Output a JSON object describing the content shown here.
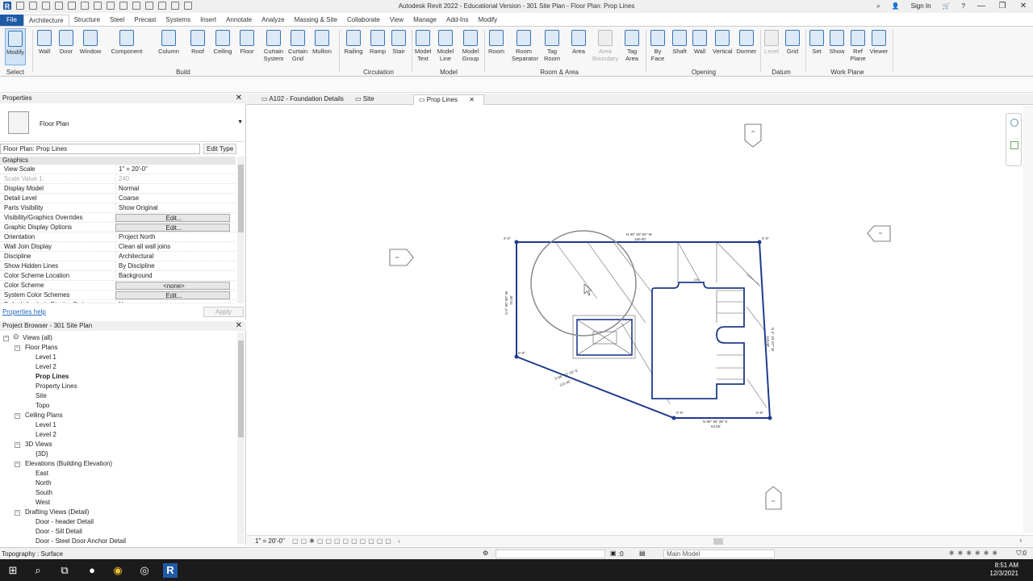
{
  "window": {
    "title": "Autodesk Revit 2022 - Educational Version - 301 Site Plan - Floor Plan: Prop Lines",
    "sign_in": "Sign In"
  },
  "ribbon_tabs": [
    "File",
    "Architecture",
    "Structure",
    "Steel",
    "Precast",
    "Systems",
    "Insert",
    "Annotate",
    "Analyze",
    "Massing & Site",
    "Collaborate",
    "View",
    "Manage",
    "Add-Ins",
    "Modify"
  ],
  "ribbon_active_tab": "Architecture",
  "ribbon": {
    "select_label": "Select",
    "buttons": [
      {
        "id": "modify",
        "label": "Modify"
      },
      {
        "id": "wall",
        "label": "Wall"
      },
      {
        "id": "door",
        "label": "Door"
      },
      {
        "id": "window",
        "label": "Window"
      },
      {
        "id": "component",
        "label": "Component"
      },
      {
        "id": "column",
        "label": "Column"
      },
      {
        "id": "roof",
        "label": "Roof"
      },
      {
        "id": "ceiling",
        "label": "Ceiling"
      },
      {
        "id": "floor",
        "label": "Floor"
      },
      {
        "id": "curtain-system",
        "label": "Curtain System"
      },
      {
        "id": "curtain-grid",
        "label": "Curtain Grid"
      },
      {
        "id": "mullion",
        "label": "Mullion"
      },
      {
        "id": "railing",
        "label": "Railing"
      },
      {
        "id": "ramp",
        "label": "Ramp"
      },
      {
        "id": "stair",
        "label": "Stair"
      },
      {
        "id": "model-text",
        "label": "Model Text"
      },
      {
        "id": "model-line",
        "label": "Model Line"
      },
      {
        "id": "model-group",
        "label": "Model Group"
      },
      {
        "id": "room",
        "label": "Room"
      },
      {
        "id": "room-separator",
        "label": "Room Separator"
      },
      {
        "id": "tag-room",
        "label": "Tag Room"
      },
      {
        "id": "area",
        "label": "Area"
      },
      {
        "id": "area-boundary",
        "label": "Area Boundary"
      },
      {
        "id": "tag-area",
        "label": "Tag Area"
      },
      {
        "id": "by-face",
        "label": "By Face"
      },
      {
        "id": "shaft",
        "label": "Shaft"
      },
      {
        "id": "opening-wall",
        "label": "Wall"
      },
      {
        "id": "vertical",
        "label": "Vertical"
      },
      {
        "id": "dormer",
        "label": "Dormer"
      },
      {
        "id": "level",
        "label": "Level"
      },
      {
        "id": "grid",
        "label": "Grid"
      },
      {
        "id": "set",
        "label": "Set"
      },
      {
        "id": "show",
        "label": "Show"
      },
      {
        "id": "ref-plane",
        "label": "Ref Plane"
      },
      {
        "id": "viewer",
        "label": "Viewer"
      }
    ],
    "panels": [
      "Build",
      "Circulation",
      "Model",
      "Room & Area",
      "Opening",
      "Datum",
      "Work Plane"
    ]
  },
  "properties": {
    "header": "Properties",
    "type_name": "Floor Plan",
    "instance_selector": "Floor Plan: Prop Lines",
    "edit_type": "Edit Type",
    "group": "Graphics",
    "rows": [
      {
        "key": "View Scale",
        "value": "1\" = 20'-0\""
      },
      {
        "key": "Scale Value    1:",
        "value": "240"
      },
      {
        "key": "Display Model",
        "value": "Normal"
      },
      {
        "key": "Detail Level",
        "value": "Coarse"
      },
      {
        "key": "Parts Visibility",
        "value": "Show Original"
      },
      {
        "key": "Visibility/Graphics Overrides",
        "value": "Edit..."
      },
      {
        "key": "Graphic Display Options",
        "value": "Edit..."
      },
      {
        "key": "Orientation",
        "value": "Project North"
      },
      {
        "key": "Wall Join Display",
        "value": "Clean all wall joins"
      },
      {
        "key": "Discipline",
        "value": "Architectural"
      },
      {
        "key": "Show Hidden Lines",
        "value": "By Discipline"
      },
      {
        "key": "Color Scheme Location",
        "value": "Background"
      },
      {
        "key": "Color Scheme",
        "value": "<none>"
      },
      {
        "key": "System Color Schemes",
        "value": "Edit..."
      },
      {
        "key": "Default Analysis Display Style",
        "value": "None"
      }
    ],
    "help_link": "Properties help",
    "apply": "Apply"
  },
  "browser": {
    "header": "Project Browser - 301 Site Plan",
    "items": [
      {
        "label": "Views (all)",
        "level": 0,
        "expander": "−"
      },
      {
        "label": "Floor Plans",
        "level": 1,
        "expander": "−"
      },
      {
        "label": "Level 1",
        "level": 2
      },
      {
        "label": "Level 2",
        "level": 2
      },
      {
        "label": "Prop Lines",
        "level": 2,
        "bold": true
      },
      {
        "label": "Property Lines",
        "level": 2
      },
      {
        "label": "Site",
        "level": 2
      },
      {
        "label": "Topo",
        "level": 2
      },
      {
        "label": "Ceiling Plans",
        "level": 1,
        "expander": "−"
      },
      {
        "label": "Level 1",
        "level": 2
      },
      {
        "label": "Level 2",
        "level": 2
      },
      {
        "label": "3D Views",
        "level": 1,
        "expander": "−"
      },
      {
        "label": "{3D}",
        "level": 2
      },
      {
        "label": "Elevations (Building Elevation)",
        "level": 1,
        "expander": "−"
      },
      {
        "label": "East",
        "level": 2
      },
      {
        "label": "North",
        "level": 2
      },
      {
        "label": "South",
        "level": 2
      },
      {
        "label": "West",
        "level": 2
      },
      {
        "label": "Drafting Views (Detail)",
        "level": 1,
        "expander": "−"
      },
      {
        "label": "Door - header Detail",
        "level": 2
      },
      {
        "label": "Door - Sill Detail",
        "level": 2
      },
      {
        "label": "Door - Steel Door Anchor Detail",
        "level": 2
      }
    ]
  },
  "view_tabs": [
    {
      "label": "A102 - Foundation Details",
      "active": false
    },
    {
      "label": "Site",
      "active": false
    },
    {
      "label": "Prop Lines",
      "active": true
    }
  ],
  "drawing": {
    "top_bearing": "N 90° 00' 00\" W",
    "top_length": "180.00'",
    "left_bearing": "S 0° 00' 00\" W",
    "left_length": "75.00'",
    "diag_bearing": "S 66° 52' 05\" E",
    "diag_length": "110.45'",
    "right_bearing": "N 3° 10' 07\" W",
    "right_length": "110.00'",
    "bottom_bearing": "N 89° 59' 39\" E",
    "bottom_length": "63.50'",
    "corner_labels": [
      "0'-0\"",
      "0'-0\"",
      "0'-0\"",
      "0'-0\"",
      "0'-0\""
    ],
    "dn_label": "DN"
  },
  "view_control": {
    "scale": "1\" = 20'-0\""
  },
  "status": {
    "text": "Topography : Surface",
    "zero": ":0",
    "model": "Main Model"
  },
  "taskbar": {
    "time": "8:51 AM",
    "date": "12/3/2021"
  }
}
